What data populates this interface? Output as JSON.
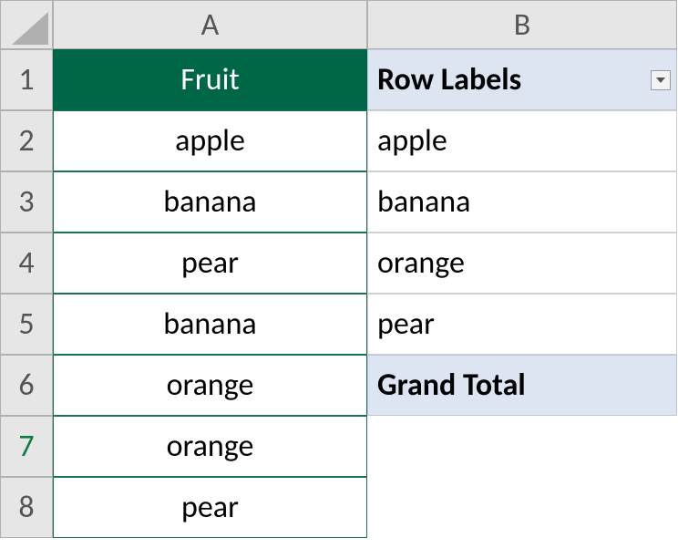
{
  "columns": [
    "A",
    "B"
  ],
  "rows": [
    "1",
    "2",
    "3",
    "4",
    "5",
    "6",
    "7",
    "8"
  ],
  "selectedRow": 7,
  "colA": {
    "header": "Fruit",
    "values": [
      "apple",
      "banana",
      "pear",
      "banana",
      "orange",
      "orange",
      "pear"
    ]
  },
  "colB": {
    "header": "Row Labels",
    "values": [
      "apple",
      "banana",
      "orange",
      "pear"
    ],
    "total": "Grand Total"
  },
  "colors": {
    "tableHeaderBg": "#006648",
    "pivotBg": "#dde4f2"
  }
}
